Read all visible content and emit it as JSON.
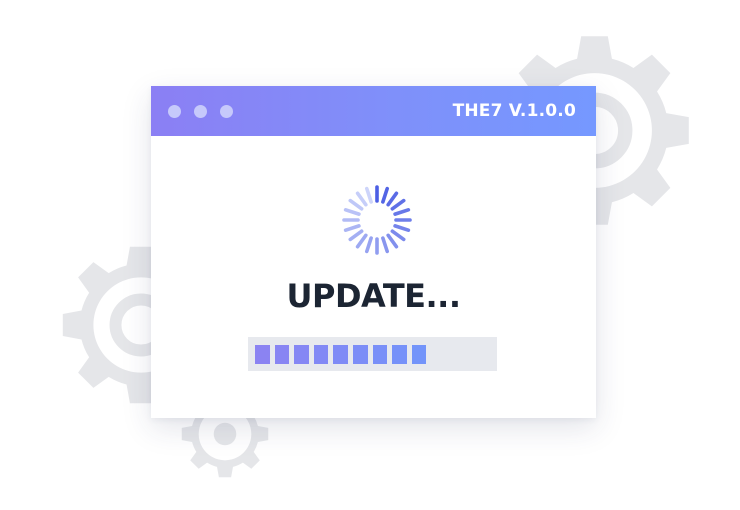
{
  "window": {
    "title": "THE7 V.1.0.0",
    "controls": [
      "dot",
      "dot",
      "dot"
    ]
  },
  "spinner": {
    "icon": "loading-spinner-icon",
    "accent_color": "#4c5fe4"
  },
  "status": {
    "text": "UPDATE..."
  },
  "progress": {
    "percent": 70,
    "filled_segments": 9,
    "segment_colors": [
      "#8b83f2",
      "#8885f3",
      "#8587f4",
      "#8289f5",
      "#7f8bf6",
      "#7c8df7",
      "#798ff8",
      "#7691f9",
      "#7394fa"
    ],
    "track_color": "#e7e9ee"
  },
  "decorations": {
    "icons": [
      "gear-icon",
      "gear-icon",
      "gear-icon"
    ],
    "color": "#e5e6e9"
  }
}
